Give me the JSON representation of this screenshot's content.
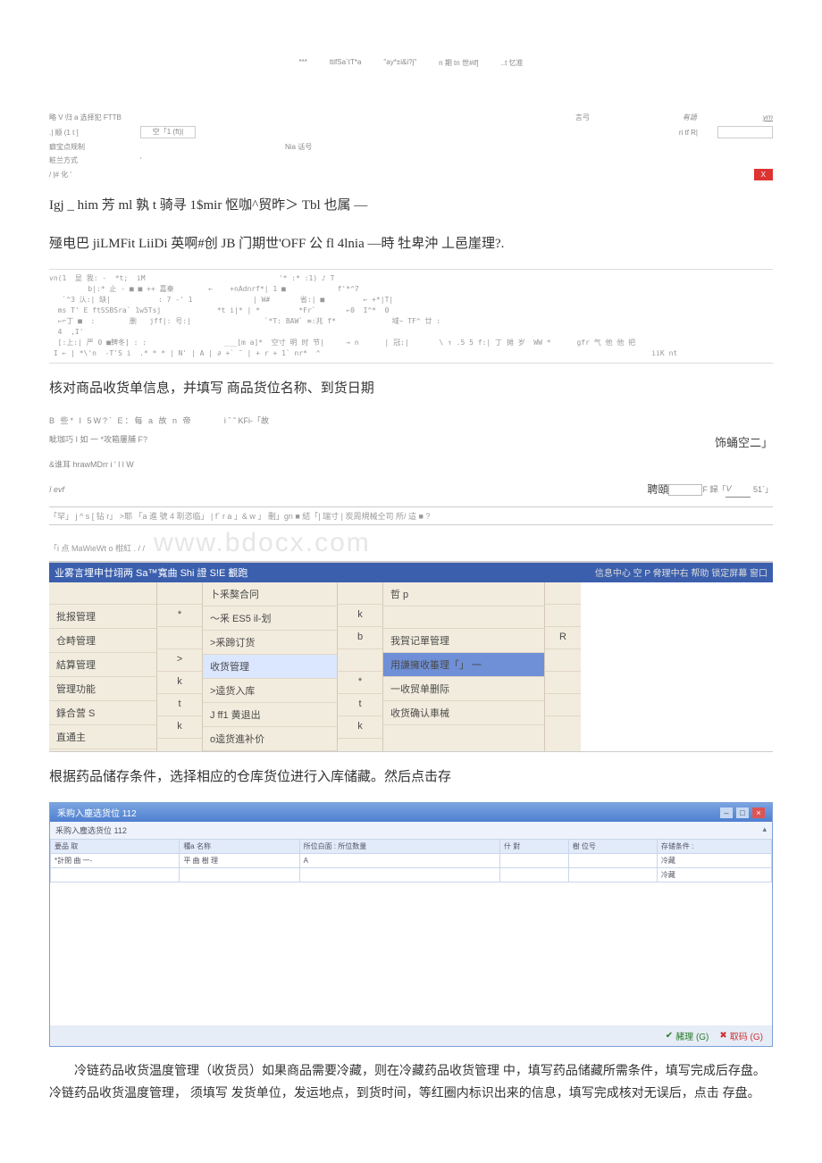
{
  "top_tiny": {
    "a": "***",
    "b": "ttifSa`tT*a",
    "c": "\"ay*±i&i?j\"",
    "d": "n 期 tn 世#if]",
    "e": "..t 忆准"
  },
  "form1": {
    "r1_a": "略 V 归 a 选择犯 FTTB",
    "r1_b": "言弓",
    "r1_c": "有語",
    "r1_d": "yrn",
    "r2_a": ".| 顺 (1 t ]",
    "r2_btn": "空「1 (ft)|",
    "r2_c": "ri tf R|",
    "r3_a": "癖宝点规制",
    "r3_b": "Nia 话号",
    "r4_a": "粧兰方式",
    "r4_b": "'",
    "r5_a": "/ |# 化 '",
    "close": "X"
  },
  "main1": "Igj _ him 芳 ml 孰 t 骑寻 1$mir 怄咖^贸昨＞ Tbl 也属 —",
  "main2": "殛电巴 jiLMFit LiiDi 英啊#创 JB 门期世'OFF 公 fl 4lnia —時 牡卑沖 丄邑崖理?.",
  "garble1": "vn(1  显 我: -  *t;  iM                               '* :* :1) ♪ T                  \n         b|:* 止 - ■ ■ ++ 嘉秦        ←    +nAdnrf*| 1 ■            f'*^7           \n   `^3 汄:| 缺|           : 7 -' 1              | W#       省:| ■         ← +*|T|    \n  ms T' E ftSSBSra` 1w5Tsj             *t i|* | *         *Fr`       ←0  I^*  0       \n  ←⌐丁 ■  :        删   jff|: 号:|                 `*T: BAW` ≡:兆 f*             域~ TF^ 廿 :  \n  4  ,I'                                                                                      \n  [:上:| 严 0 ■鞞冬] : :                  ___[m a]*  空寸 明 时 节|     → n      | 冠:|       \\ ↑ .5 5 f:| 丁 摊 岁  WW *      gfr 气 他 他 把\n I ← | *\\'n  -T'S i  .* * * | N' | A | ∂ +` ˜ | + r + 1` nr*  ^                                                                             iiK nt",
  "main3": "核对商品收货单信息，并填写 商品货位名称、到货日期",
  "form2": {
    "l1_a": "B 些* I  5W?` E：每 a 故 n 帝",
    "l1_b": "ì ˆ ˜ KFi-「故",
    "l2": "眦珈巧 I 如 一 *攻箱屢脯 F?",
    "l2r": "饰蛹空二」",
    "l3": "&谁耳 hrawMDrr  i  ' l l   W",
    "l4": "ï evf",
    "l4r_a": "聘頤",
    "l4r_b": "F",
    "l4r_c": "歸「",
    "l4r_d": "V",
    "l4r_e": "51`」"
  },
  "wm": {
    "row_left": "「罕」 j ^ s  [ 钻 r」           >耶    「a 進 號 4 刵恣临」 | f` r a 」& w 」 刪」gn ■ 結「|  瑞寸 | 炭周規械仝司 所/ 這 ■ ?",
    "row_b_left": "「i 点           MaWieWt o 柑紅   .  /  /",
    "big": "www.bdocx.com"
  },
  "menu": {
    "header_left": "业雾言埋申廿翊两 Sa™寬曲 Shi 證 S!E 覾跑",
    "header_right": "信息中心  空 P 脅理中右  帮助  锁定屏幕  窗口",
    "colA": [
      "",
      "批报管理",
      "仓畤管理",
      "結算管理",
      "管理功能",
      "錄合营 S",
      "直通主"
    ],
    "colB": [
      "",
      "*",
      "",
      ">",
      "k",
      "t",
      "k"
    ],
    "colC": [
      "卜釆獒合冋",
      "〜釆 ES5 il-划",
      ">釆蹄订货",
      "收货管理",
      ">逵货入库",
      "J  ff1 黄退出",
      "o逵货進补价"
    ],
    "colD": [
      "",
      "k",
      "b",
      "",
      "*",
      "t",
      "k"
    ],
    "colE_top": "哲 p",
    "colE": [
      "",
      "",
      "我賀记單管理",
      "用謙擁收箠理「」 一",
      "一收贸单删际",
      "收货确认車械"
    ],
    "colF": [
      "",
      "",
      "R",
      "",
      "",
      ""
    ]
  },
  "main4": "根据药品储存条件，选择相应的仓库货位进行入库储藏。然后点击存",
  "panel": {
    "title": "釆购入塵选货位 112",
    "sub_left": "釆购入塵选货位 112",
    "sub_right": "",
    "th": [
      "要品 取",
      "種a 名称",
      "所位白面 :  所位数量",
      "什 對",
      "樹 位号",
      "存储条件 :"
    ],
    "r1": [
      "*計閉 曲 一-",
      "平 曲 樹 理",
      "A",
      "冷藏"
    ],
    "r2": [
      "",
      "",
      "",
      "冷藏"
    ],
    "ok": "赭理 (G)",
    "cancel": "取码 (G)"
  },
  "para": "冷链药品收货温度管理（收货员）如果商品需要冷藏，则在冷藏药品收货管理 中，填写药品储藏所需条件，填写完成后存盘。冷链药品收货温度管理， 须填写 发货单位，发运地点，到货时间，等红圈内标识出来的信息，填写完成核对无误后，点击 存盘。"
}
